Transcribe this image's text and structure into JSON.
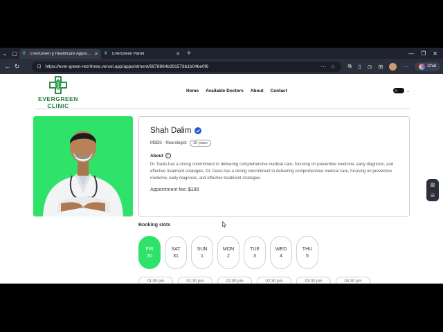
{
  "browser": {
    "tabs": [
      {
        "title": "EverGreen || Healthcare Appointm",
        "active": true
      },
      {
        "title": "EverGreen Panel",
        "active": false
      }
    ],
    "url": "https://ever-green-red-three.vercel.app/appointment/6978864b391576b1b04be0f6",
    "chat_label": "Chat"
  },
  "site": {
    "brand_line1": "EVERGREEN",
    "brand_line2": "CLINIC",
    "nav": [
      "Home",
      "Available Doctors",
      "About",
      "Contact"
    ]
  },
  "doctor": {
    "name": "Shah Dalim",
    "degree": "MBBS - Neurologist",
    "experience": "10 years",
    "about_label": "About",
    "about_text": "Dr. Davis has a strong commitment to delivering comprehensive medical care, focusing on preventive medicine, early diagnosis, and effective treatment strategies. Dr. Davis has a strong commitment to delivering comprehensive medical care, focusing on preventive medicine, early diagnosis, and effective treatment strategies.",
    "fee_label": "Appointment fee:",
    "fee_value": "$100"
  },
  "booking": {
    "title": "Booking slots",
    "days": [
      {
        "day": "FRI",
        "date": "30",
        "selected": true
      },
      {
        "day": "SAT",
        "date": "31",
        "selected": false
      },
      {
        "day": "SUN",
        "date": "1",
        "selected": false
      },
      {
        "day": "MON",
        "date": "2",
        "selected": false
      },
      {
        "day": "TUE",
        "date": "3",
        "selected": false
      },
      {
        "day": "WED",
        "date": "4",
        "selected": false
      },
      {
        "day": "THU",
        "date": "5",
        "selected": false
      }
    ],
    "times": [
      "01:00 pm",
      "01:30 pm",
      "02:00 pm",
      "02:30 pm",
      "03:00 pm",
      "03:30 pm"
    ]
  },
  "colors": {
    "accent_green": "#2fe36a",
    "brand_green": "#1f7a3a",
    "verified_blue": "#2457d6"
  }
}
